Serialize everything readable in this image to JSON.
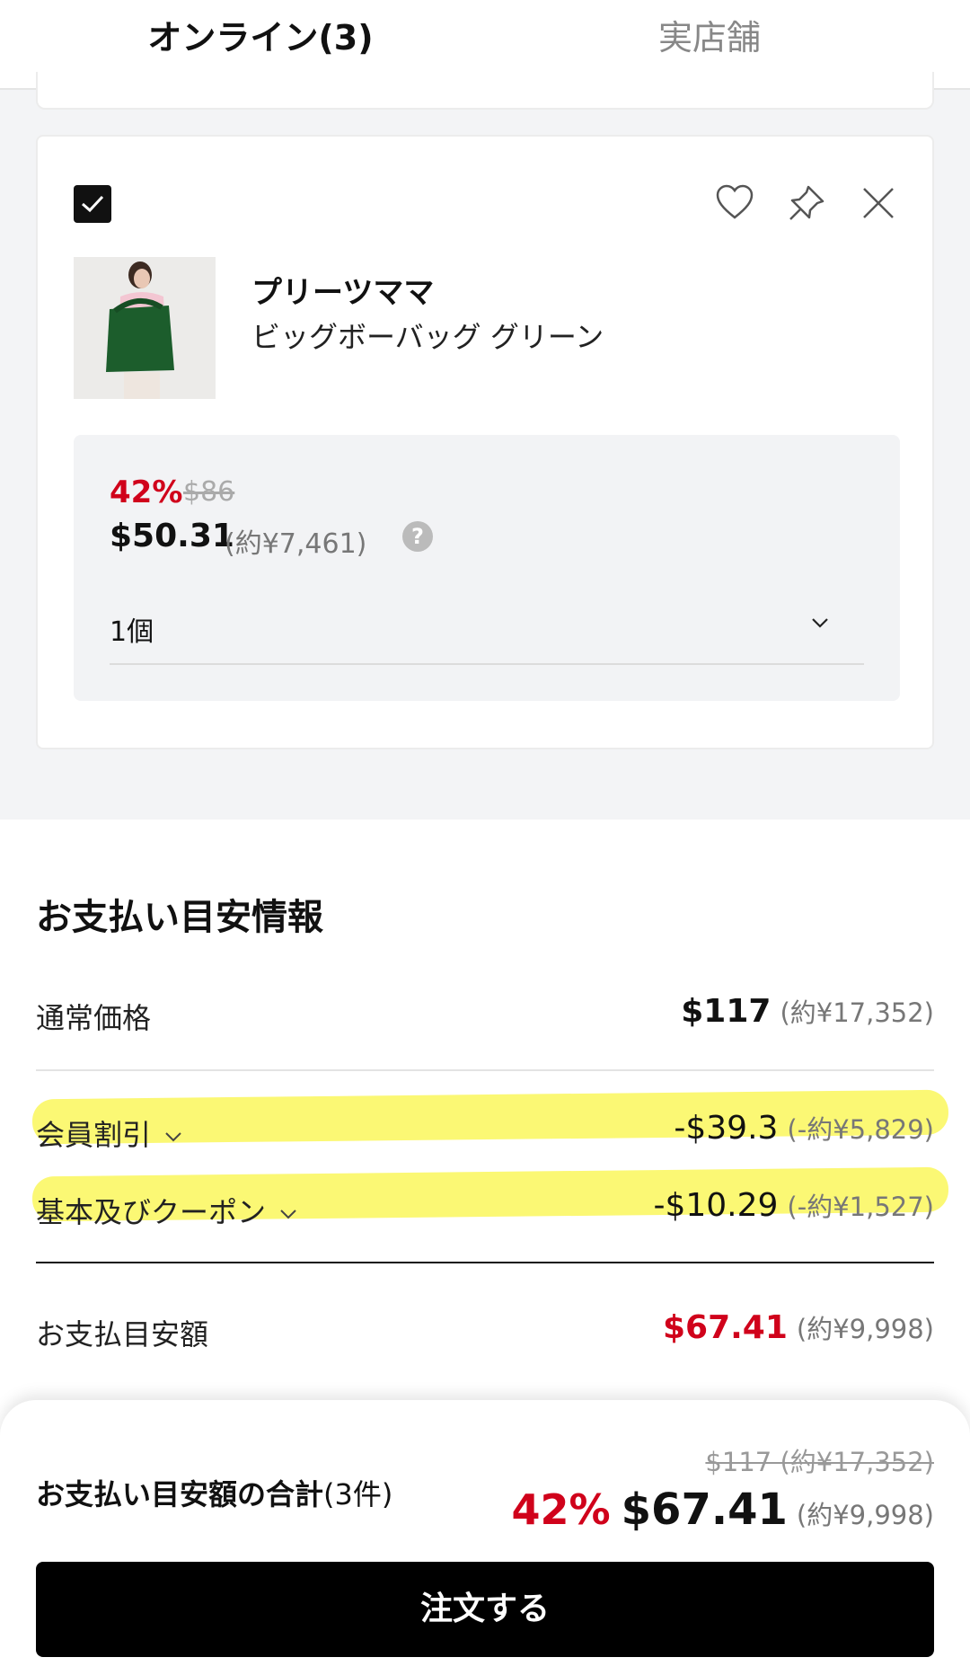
{
  "tabs": [
    {
      "label": "オンライン(3)",
      "active": true
    },
    {
      "label": "実店舗",
      "active": false
    }
  ],
  "product": {
    "checked": true,
    "brand": "プリーツママ",
    "name": "ビッグボーバッグ グリーン",
    "discount": "42%",
    "original_price": "$86",
    "price": "$50.31",
    "price_yen": "(約¥7,461)",
    "help": "?",
    "quantity": "1個",
    "icons": [
      "heart-icon",
      "pin-icon",
      "close-icon",
      "checkmark-icon",
      "chevron-down-icon"
    ]
  },
  "payment": {
    "title": "お支払い目安情報",
    "regular_label": "通常価格",
    "regular_amount": "$117",
    "regular_yen": "(約¥17,352)",
    "member_label": "会員割引",
    "member_amount": "-$39.3",
    "member_yen": "(-約¥5,829)",
    "coupon_label": "基本及びクーポン",
    "coupon_amount": "-$10.29",
    "coupon_yen": "(-約¥1,527)",
    "estimate_label": "お支払目安額",
    "estimate_amount": "$67.41",
    "estimate_yen": "(約¥9,998)"
  },
  "summary": {
    "label": "お支払い目安額の合計",
    "count": "(3件)",
    "original": "$117 (約¥17,352)",
    "discount": "42%",
    "total": "$67.41",
    "total_yen": "(約¥9,998)",
    "order_button": "注文する"
  },
  "colors": {
    "accent_red": "#d0021b",
    "highlight": "#faf546",
    "button": "#000000"
  }
}
